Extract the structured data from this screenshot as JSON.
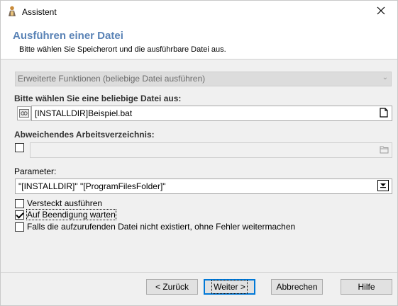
{
  "window": {
    "title": "Assistent",
    "icon": "app-icon",
    "close_icon": "close-icon"
  },
  "header": {
    "title": "Ausführen einer Datei",
    "subtitle": "Bitte wählen Sie Speicherort und die ausführbare Datei aus."
  },
  "function_combo": {
    "value": "Erweiterte Funktionen (beliebige Datei ausführen)",
    "enabled": false
  },
  "file": {
    "label": "Bitte wählen Sie eine beliebige Datei aus:",
    "value": "[INSTALLDIR]Beispiel.bat",
    "browse_icon": "document-icon"
  },
  "workdir": {
    "label": "Abweichendes Arbeitsverzeichnis:",
    "checked": false,
    "value": "",
    "browse_icon": "folder-icon"
  },
  "params": {
    "label": "Parameter:",
    "value": "\"[INSTALLDIR]\" \"[ProgramFilesFolder]\""
  },
  "options": [
    {
      "label": "Versteckt ausführen",
      "checked": false
    },
    {
      "label": "Auf Beendigung warten",
      "checked": true
    },
    {
      "label": "Falls die aufzurufenden Datei nicht existiert, ohne Fehler weitermachen",
      "checked": false
    }
  ],
  "buttons": {
    "back": "< Zurück",
    "next": "Weiter >",
    "cancel": "Abbrechen",
    "help": "Hilfe"
  },
  "colors": {
    "header_title": "#5a83b6",
    "default_button_border": "#0078d7"
  }
}
